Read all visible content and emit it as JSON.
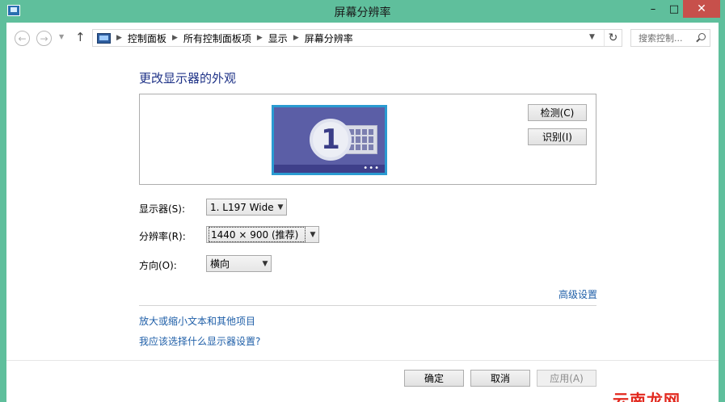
{
  "window": {
    "title": "屏幕分辨率"
  },
  "window_controls": {
    "minimize": "–",
    "maximize": "□",
    "close": "✕"
  },
  "nav": {
    "back": "←",
    "forward": "→",
    "up": "↑",
    "breadcrumb": [
      "控制面板",
      "所有控制面板项",
      "显示",
      "屏幕分辨率"
    ],
    "refresh": "↻",
    "search_placeholder": "搜索控制..."
  },
  "content": {
    "heading": "更改显示器的外观",
    "monitor_number": "1",
    "detect_label": "检测(C)",
    "identify_label": "识别(I)",
    "display_label": "显示器(S):",
    "display_value": "1. L197 Wide",
    "resolution_label": "分辨率(R):",
    "resolution_value": "1440 × 900 (推荐)",
    "orientation_label": "方向(O):",
    "orientation_value": "横向",
    "advanced_link": "高级设置",
    "text_size_link": "放大或缩小文本和其他项目",
    "which_settings_link": "我应该选择什么显示器设置?"
  },
  "footer": {
    "ok_label": "确定",
    "cancel_label": "取消",
    "apply_label": "应用(A)"
  },
  "watermark": "云南龙网",
  "colors": {
    "titlebar": "#5fbf9c",
    "link": "#1f5fa8",
    "heading": "#1e3287",
    "close": "#c7504b"
  }
}
